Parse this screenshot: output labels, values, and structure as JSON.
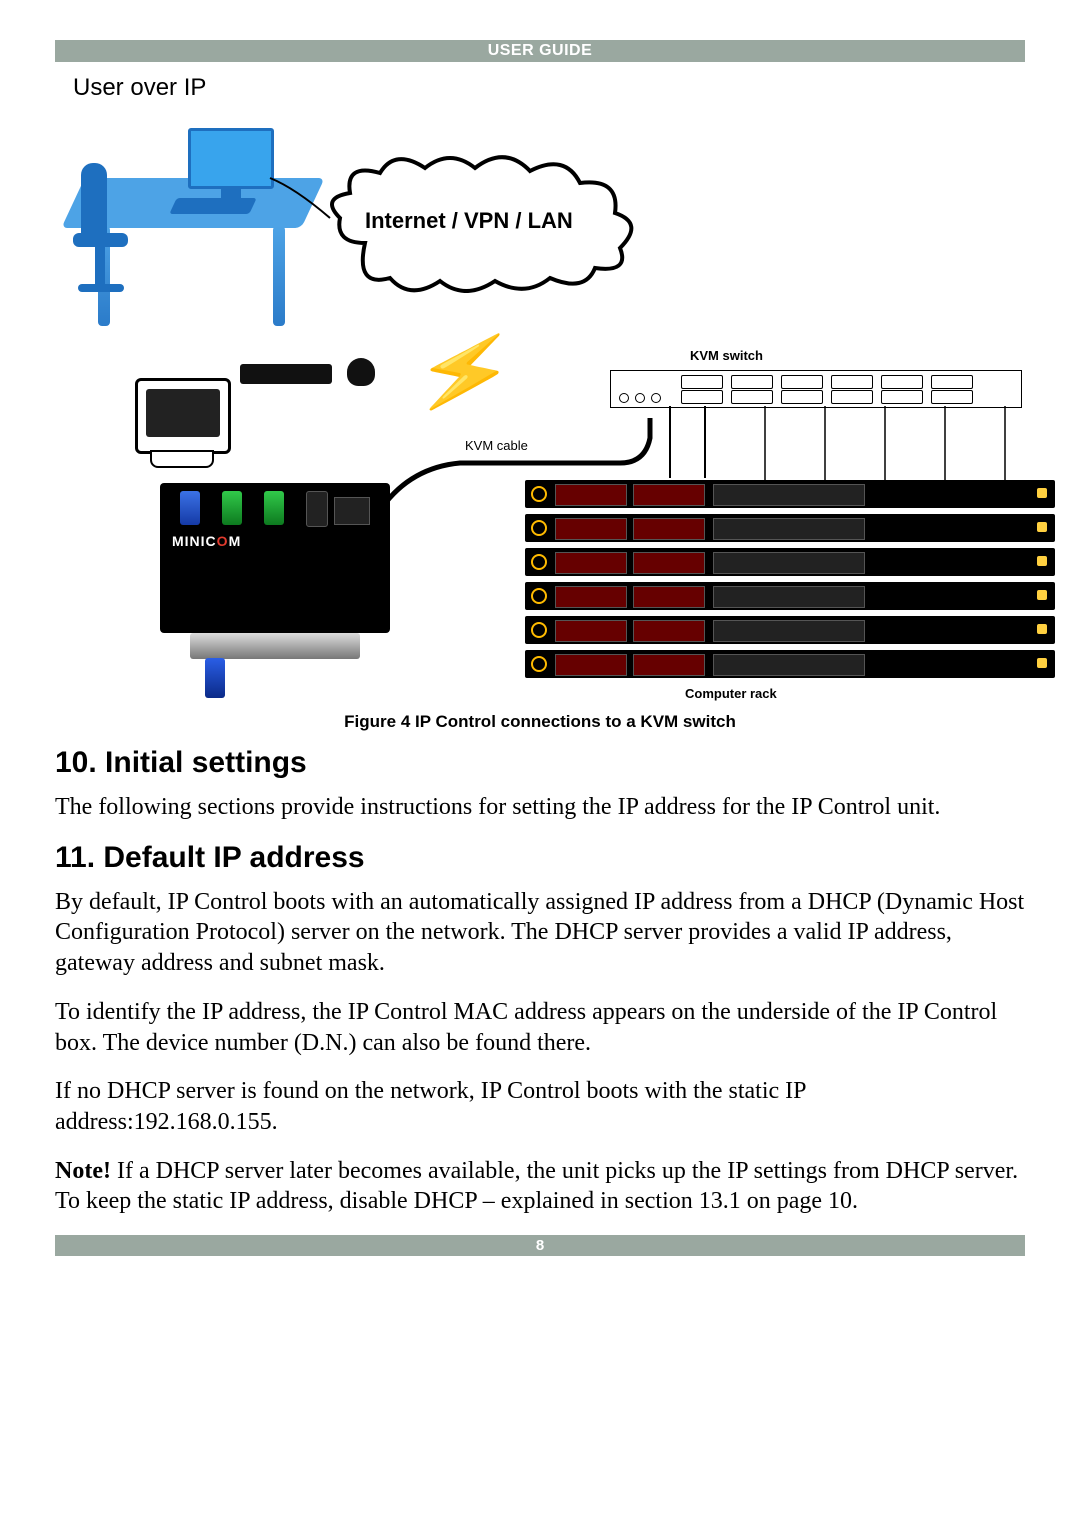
{
  "header": {
    "title": "USER GUIDE"
  },
  "diagram": {
    "user_over_ip": "User over IP",
    "cloud_label": "Internet / VPN / LAN",
    "kvm_cable": "KVM cable",
    "kvm_switch": "KVM switch",
    "computer_rack": "Computer rack",
    "brand_prefix": "MINIC",
    "brand_o": "O",
    "brand_suffix": "M"
  },
  "figure_caption": "Figure 4 IP Control connections to a KVM switch",
  "sections": {
    "s10_title": "10. Initial settings",
    "s10_p1": "The following sections provide instructions for setting the IP address for the IP Control unit.",
    "s11_title": "11. Default IP address",
    "s11_p1": "By default, IP Control boots with an automatically assigned IP address from a DHCP (Dynamic Host Configuration Protocol) server on the network. The DHCP server provides a valid IP address, gateway address and subnet mask.",
    "s11_p2": "To identify the IP address, the IP Control MAC address appears on the underside of the IP Control box. The device number (D.N.) can also be found there.",
    "s11_p3": "If no DHCP server is found on the network, IP Control boots with the static IP address:192.168.0.155.",
    "s11_note_label": "Note!",
    "s11_note_body": " If a DHCP server later becomes available, the unit picks up the IP settings from DHCP server. To keep the static IP address, disable DHCP – explained in section 13.1 on page 10."
  },
  "footer": {
    "page_number": "8"
  }
}
